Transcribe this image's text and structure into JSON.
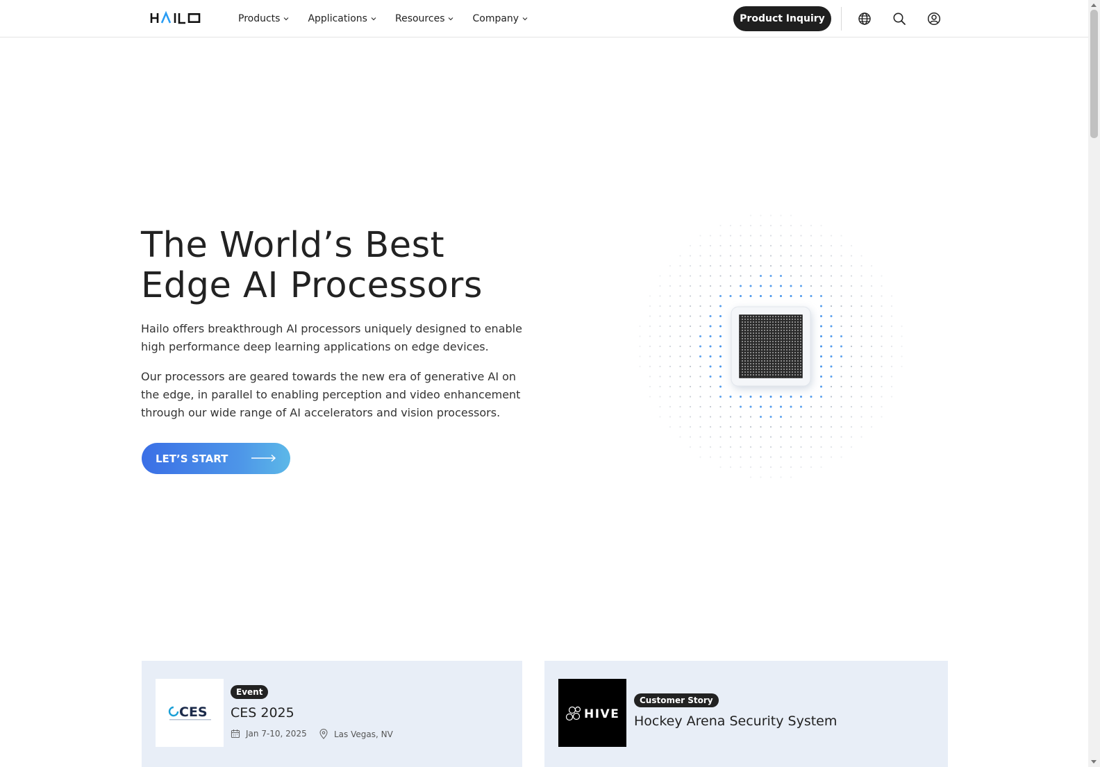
{
  "header": {
    "logo": "HAILO",
    "nav": [
      "Products",
      "Applications",
      "Resources",
      "Company"
    ],
    "inquiry_label": "Product Inquiry"
  },
  "hero": {
    "title_line1": "The World’s Best",
    "title_line2": "Edge AI Processors",
    "paragraph1": "Hailo offers breakthrough AI processors uniquely designed to enable high performance deep learning applications on edge devices.",
    "paragraph2": "Our processors are geared towards the new era of generative AI on the edge, in parallel to enabling perception and video enhancement through our wide range of AI accelerators and vision processors.",
    "cta_label": "LET’S START"
  },
  "cards": [
    {
      "badge": "Event",
      "title": "CES 2025",
      "date": "Jan 7-10, 2025",
      "location": "Las Vegas, NV",
      "logo_text": "CES"
    },
    {
      "badge": "Customer Story",
      "title": "Hockey Arena Security System",
      "logo_text": "HIVE"
    }
  ],
  "colors": {
    "accent_start": "#3a6fe6",
    "accent_end": "#5cb8e8",
    "dark": "#1f1f1f",
    "card_bg": "#e8eef7"
  }
}
